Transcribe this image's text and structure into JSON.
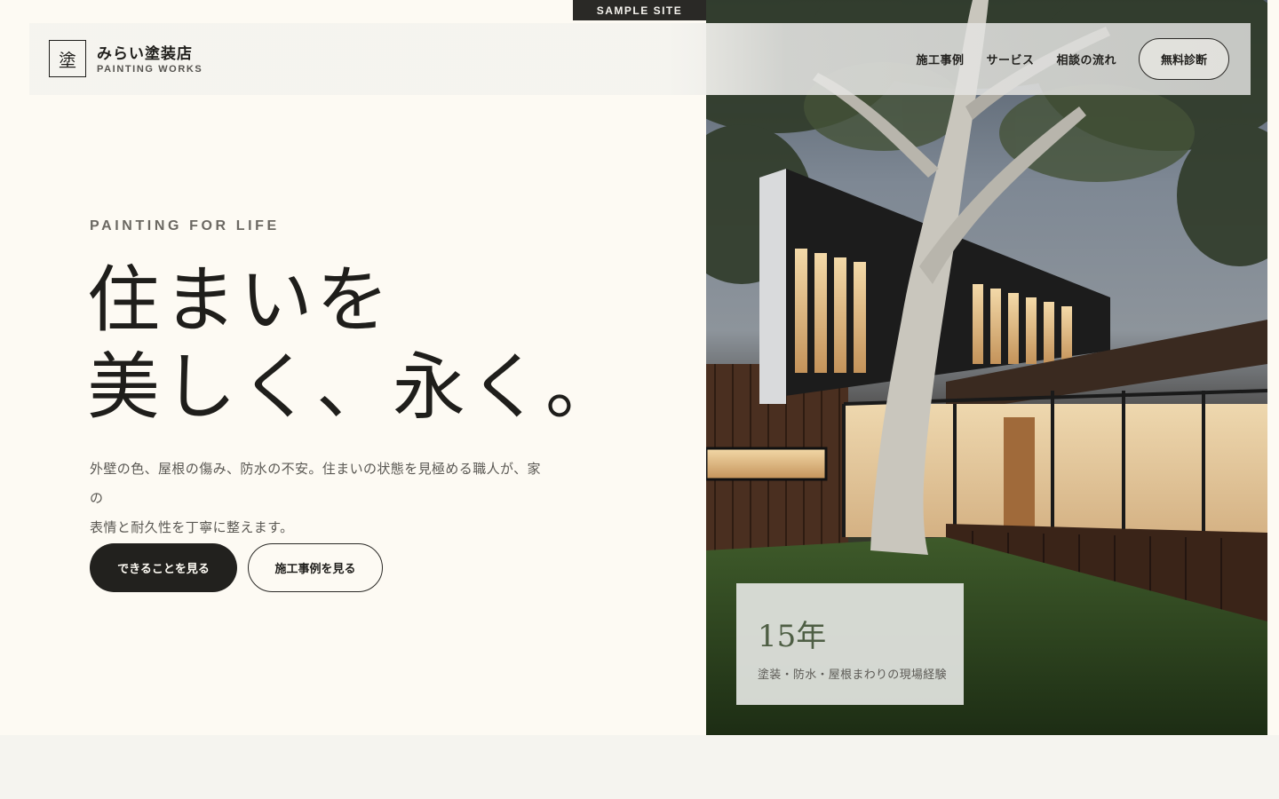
{
  "sample_tag": "SAMPLE SITE",
  "brand": {
    "mark": "塗",
    "name": "みらい塗装店",
    "sub": "PAINTING WORKS"
  },
  "nav": {
    "items": [
      "施工事例",
      "サービス",
      "相談の流れ"
    ],
    "cta": "無料診断"
  },
  "hero": {
    "eyebrow": "PAINTING FOR LIFE",
    "headline_line1": "住まいを",
    "headline_line2": "美しく、永く。",
    "lead_line1": "外壁の色、屋根の傷み、防水の不安。住まいの状態を見極める職人が、家の",
    "lead_line2": "表情と耐久性を丁寧に整えます。",
    "primary_button": "できることを見る",
    "secondary_button": "施工事例を見る"
  },
  "stat": {
    "value": "15年",
    "caption": "塗装・防水・屋根まわりの現場経験"
  },
  "colors": {
    "page_bg": "#fdfaf3",
    "ink": "#1f1e1b",
    "accent_green": "#4e5e44",
    "footer_bg": "#f5f4ef"
  },
  "image": {
    "subject": "modern-house-photo"
  }
}
